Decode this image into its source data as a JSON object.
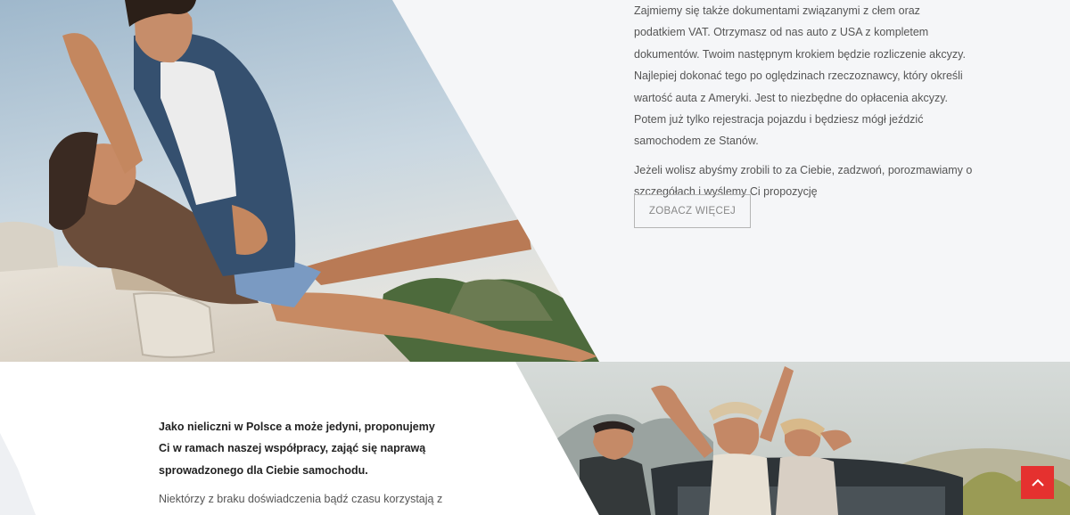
{
  "top_section": {
    "paragraph_1": "Zajmiemy się także dokumentami związanymi z cłem oraz podatkiem VAT. Otrzymasz od nas auto z USA z kompletem dokumentów. Twoim następnym krokiem będzie rozliczenie akcyzy. Najlepiej dokonać tego po oględzinach rzeczoznawcy, który określi wartość auta z Ameryki. Jest to niezbędne do opłacenia akcyzy. Potem już tylko rejestracja pojazdu i będziesz mógł jeździć samochodem ze Stanów.",
    "paragraph_2": "Jeżeli wolisz abyśmy zrobili to za Ciebie, zadzwoń, porozmawiamy o szczegółach i wyślemy Ci propozycję",
    "button_label": "ZOBACZ WIĘCEJ"
  },
  "bottom_section": {
    "lead": "Jako nieliczni w Polsce a może jedyni, proponujemy Ci w ramach naszej współpracy, zająć się naprawą sprowadzonego dla Ciebie samochodu.",
    "paragraph": "Niektórzy z braku doświadczenia bądź czasu korzystają z"
  },
  "images": {
    "top_photo": "couple-in-convertible-photo",
    "bottom_photo": "friends-in-convertible-photo"
  },
  "colors": {
    "accent": "#e5312f",
    "section_bg": "#f5f6f8"
  },
  "icons": {
    "scroll_top": "chevron-up-icon"
  }
}
